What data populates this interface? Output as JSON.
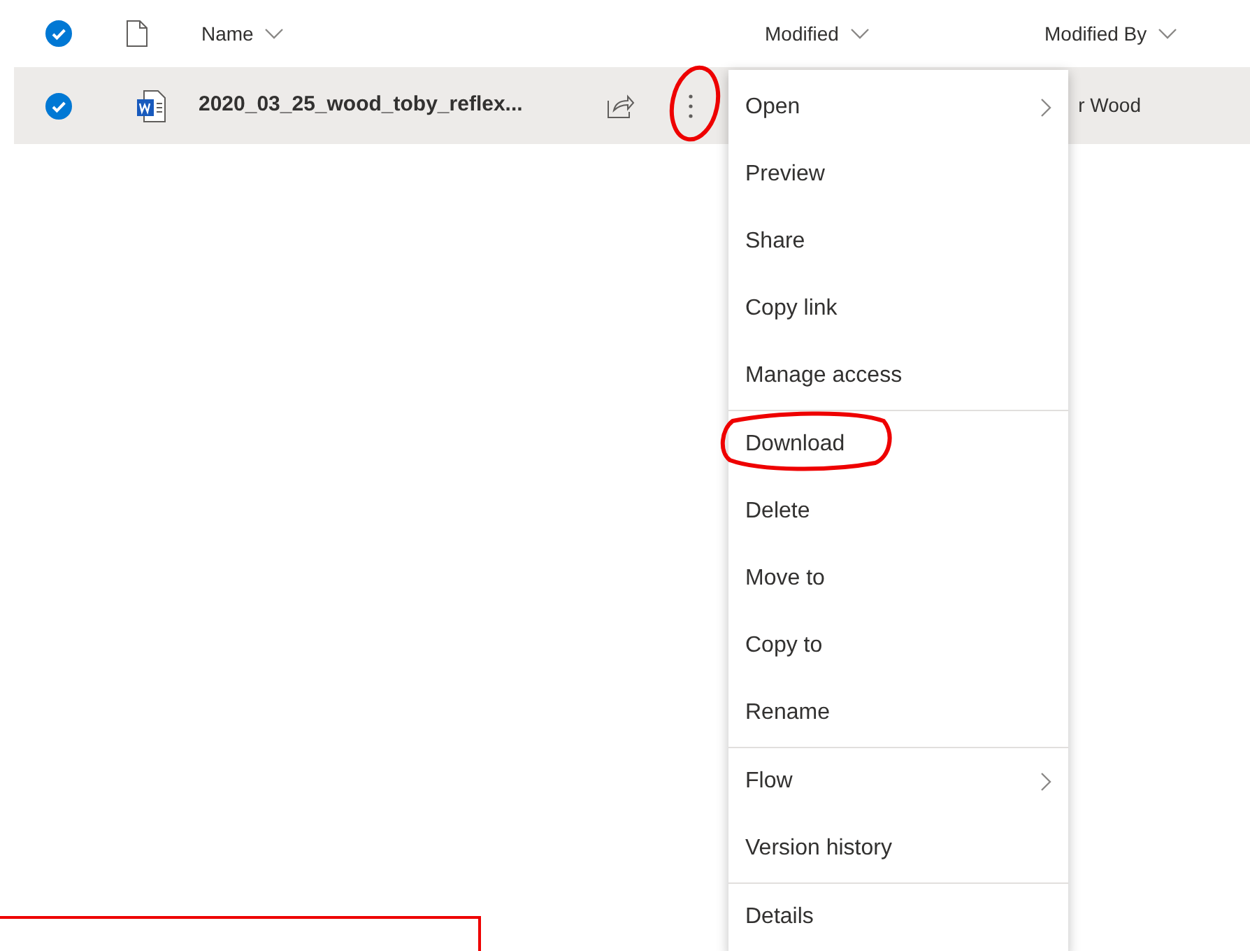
{
  "header": {
    "checked": true,
    "columns": [
      {
        "label": "Name"
      },
      {
        "label": "Modified"
      },
      {
        "label": "Modified By"
      }
    ]
  },
  "rows": [
    {
      "selected": true,
      "name": "2020_03_25_wood_toby_reflex...",
      "modified_by": "r Wood"
    }
  ],
  "context_menu": {
    "sections": [
      {
        "items": [
          {
            "label": "Open",
            "kind": "submenu"
          },
          {
            "label": "Preview",
            "kind": "item"
          },
          {
            "label": "Share",
            "kind": "item"
          },
          {
            "label": "Copy link",
            "kind": "item"
          },
          {
            "label": "Manage access",
            "kind": "item"
          }
        ]
      },
      {
        "items": [
          {
            "label": "Download",
            "kind": "item"
          },
          {
            "label": "Delete",
            "kind": "item"
          },
          {
            "label": "Move to",
            "kind": "item"
          },
          {
            "label": "Copy to",
            "kind": "item"
          },
          {
            "label": "Rename",
            "kind": "item"
          }
        ]
      },
      {
        "items": [
          {
            "label": "Flow",
            "kind": "submenu"
          },
          {
            "label": "Version history",
            "kind": "item"
          }
        ]
      },
      {
        "items": [
          {
            "label": "Details",
            "kind": "item"
          }
        ]
      }
    ]
  }
}
